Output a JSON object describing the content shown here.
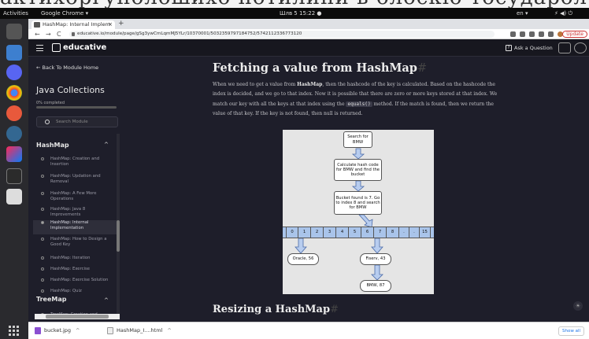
{
  "top_overlay": {
    "text": "актихоргуполошихо потилини в олоскіо тосударол"
  },
  "system": {
    "activities": "Activities",
    "app_menu": "Google Chrome ▾",
    "clock": "Шлв 5  15:22  ●",
    "lang": "en ▾",
    "tray": "⚡ ◀) ⏻"
  },
  "browser": {
    "tab_title": "HashMap: Internal Implem",
    "tab_close": "×",
    "new_tab": "+",
    "back": "←",
    "forward": "→",
    "reload": "C",
    "url": "educative.io/module/page/gSg3ywCmLqmMJ5YLr/10370001/5032359797184752/5742112336773120",
    "update_label": "Update"
  },
  "edu": {
    "logo": "educative",
    "ask_label": "Ask a Question",
    "ask_icon_glyph": "?"
  },
  "sidebar": {
    "back_label": "← Back To Module Home",
    "course_title": "Java Collections",
    "completed": "0% completed",
    "progress_percent": 0,
    "search_placeholder": "Search Module",
    "section1": "HashMap",
    "lessons": [
      "HashMap: Creation and Insertion",
      "HashMap: Updation and Removal",
      "HashMap: A Few More Operations",
      "HashMap: Java 8 Improvements",
      "HashMap: Internal Implementation",
      "HashMap: How to Design a Good Key",
      "HashMap: Iteration",
      "HashMap: Exercise",
      "HashMap: Exercise Solution",
      "HashMap: Quiz"
    ],
    "section2": "TreeMap",
    "section2_lessons": [
      "TreeMap: Creation and"
    ]
  },
  "main": {
    "heading": "Fetching a value from HashMap",
    "para_1": "When we need to get a value from ",
    "para_b": "HashMap",
    "para_2": ", then the hashcode of the key is calculated. Based on the hashcode the index is decided, and we go to that index. Now it is possible that there are zero or more keys stored at that index. We match our key with all the keys at that index using the ",
    "para_code": "equals()",
    "para_3": " method. If the match is found, then we return the value of that key. If the key is not found, then null is returned.",
    "diagram": {
      "box_search": "Search for BMW",
      "box_calc": "Calculate hash code for BMW and find the bucket",
      "box_bucket": "Bucket found is 7. Go to index 8 and search for BMW",
      "cells": [
        "0",
        "1",
        "2",
        "3",
        "4",
        "5",
        "6",
        "7",
        "8",
        ".",
        ".",
        "15"
      ],
      "node_oracle": "Oracle, 56",
      "node_fiserv": "Fiserv, 43",
      "node_bmw": "BMW, 87"
    },
    "heading2": "Resizing a HashMap"
  },
  "downloads": {
    "file1": "bucket.jpg",
    "file2": "HashMap_I....html",
    "show_all": "Show all"
  }
}
